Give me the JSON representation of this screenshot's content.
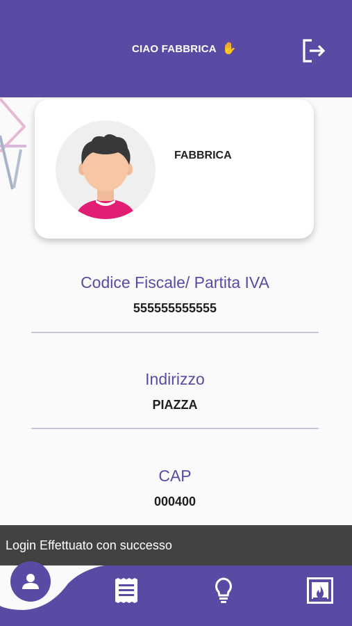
{
  "header": {
    "greeting": "CIAO FABBRICA",
    "wave_icon": "waving-hand-icon",
    "logout_icon": "logout-icon",
    "background_color": "#5b4aa3"
  },
  "profile_card": {
    "name": "FABBRICA",
    "avatar_icon": "user-avatar-icon"
  },
  "fields": [
    {
      "label": "Codice Fiscale/ Partita IVA",
      "value": "555555555555"
    },
    {
      "label": "Indirizzo",
      "value": "PIAZZA"
    },
    {
      "label": "CAP",
      "value": "000400"
    }
  ],
  "snackbar": {
    "message": "Login Effettuato con successo"
  },
  "bottom_nav": {
    "items": [
      {
        "icon": "person-icon",
        "active": true
      },
      {
        "icon": "receipt-icon",
        "active": false
      },
      {
        "icon": "lightbulb-icon",
        "active": false
      },
      {
        "icon": "fireplace-icon",
        "active": false
      }
    ]
  },
  "colors": {
    "accent": "#5b4aa3",
    "snackbar": "#424242",
    "divider": "#c9c4dd"
  }
}
